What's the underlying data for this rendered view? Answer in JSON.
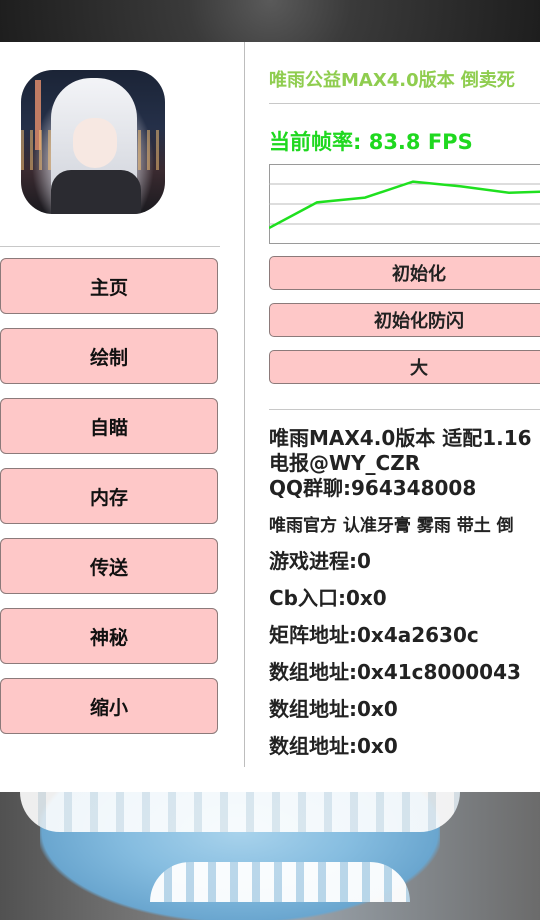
{
  "sidebar": {
    "items": [
      {
        "label": "主页"
      },
      {
        "label": "绘制"
      },
      {
        "label": "自瞄"
      },
      {
        "label": "内存"
      },
      {
        "label": "传送"
      },
      {
        "label": "神秘"
      },
      {
        "label": "缩小"
      }
    ]
  },
  "header": {
    "title": "唯雨公益MAX4.0版本 倒卖死"
  },
  "fps": {
    "label": "当前帧率: 83.8 FPS",
    "value": 83.8,
    "history": [
      20,
      52,
      58,
      78,
      72,
      64,
      66,
      70
    ]
  },
  "actions": [
    {
      "label": "初始化"
    },
    {
      "label": "初始化防闪"
    },
    {
      "label": "大"
    }
  ],
  "info": {
    "version_line": "唯雨MAX4.0版本 适配1.16",
    "telegram": "电报@WY_CZR",
    "qq_group": "QQ群聊:964348008",
    "official": "唯雨官方 认准牙膏 雾雨 带土 倒",
    "game_process": "游戏进程:0",
    "cb_entry": "Cb入口:0x0",
    "matrix_addr": "矩阵地址:0x4a2630c",
    "array_addr_1": "数组地址:0x41c8000043",
    "array_addr_2": "数组地址:0x0",
    "array_addr_3": "数组地址:0x0"
  },
  "colors": {
    "button_bg": "#fec8c8",
    "title_green": "#8fcd4f",
    "fps_green": "#1fd81f"
  }
}
